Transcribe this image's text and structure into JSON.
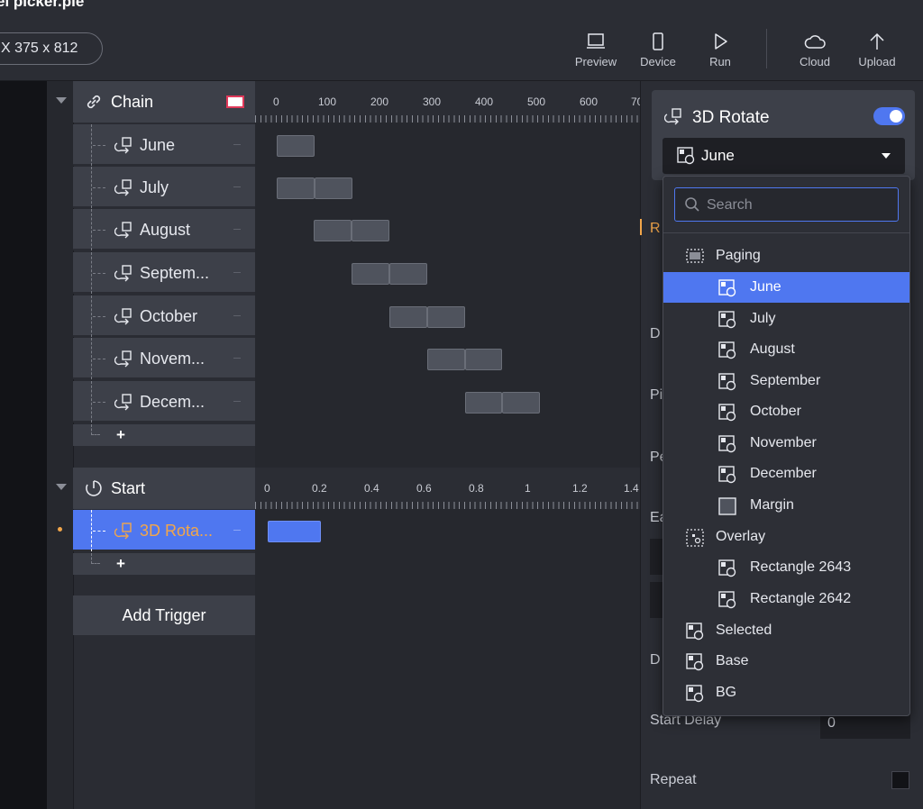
{
  "window": {
    "title": "el picker.pie"
  },
  "device": {
    "label": "X  375 x 812"
  },
  "toolbar": {
    "items": [
      {
        "label": "Preview",
        "icon": "laptop-icon"
      },
      {
        "label": "Device",
        "icon": "phone-icon"
      },
      {
        "label": "Run",
        "icon": "play-icon"
      },
      {
        "label": "Cloud",
        "icon": "cloud-icon"
      },
      {
        "label": "Upload",
        "icon": "upload-arrow-icon"
      }
    ]
  },
  "chain": {
    "title": "Chain",
    "ruler_ticks": [
      "0",
      "100",
      "200",
      "300",
      "400",
      "500",
      "600",
      "70"
    ],
    "items": [
      {
        "label": "June"
      },
      {
        "label": "July"
      },
      {
        "label": "August"
      },
      {
        "label": "Septem..."
      },
      {
        "label": "October"
      },
      {
        "label": "Novem..."
      },
      {
        "label": "Decem..."
      }
    ],
    "add_label": "+"
  },
  "start": {
    "title": "Start",
    "ruler_ticks": [
      "0",
      "0.2",
      "0.4",
      "0.6",
      "0.8",
      "1",
      "1.2",
      "1.4"
    ],
    "items": [
      {
        "label": "3D Rota..."
      }
    ],
    "add_label": "+"
  },
  "add_trigger": {
    "label": "Add Trigger"
  },
  "panel": {
    "title": "3D Rotate",
    "select_value": "June",
    "side_labels": {
      "r": "R",
      "d1": "D",
      "p1": "Pi",
      "p2": "Pe",
      "e": "Ea",
      "d2": "D",
      "start_delay": "Start Delay",
      "start_delay_value": "0",
      "repeat": "Repeat"
    }
  },
  "dropdown": {
    "search_placeholder": "Search",
    "items": [
      {
        "label": "Paging",
        "level": 0,
        "icon": "paging-group-icon"
      },
      {
        "label": "June",
        "level": 1,
        "icon": "image-layer-icon",
        "selected": true
      },
      {
        "label": "July",
        "level": 1,
        "icon": "image-layer-icon"
      },
      {
        "label": "August",
        "level": 1,
        "icon": "image-layer-icon"
      },
      {
        "label": "September",
        "level": 1,
        "icon": "image-layer-icon"
      },
      {
        "label": "October",
        "level": 1,
        "icon": "image-layer-icon"
      },
      {
        "label": "November",
        "level": 1,
        "icon": "image-layer-icon"
      },
      {
        "label": "December",
        "level": 1,
        "icon": "image-layer-icon"
      },
      {
        "label": "Margin",
        "level": 1,
        "icon": "rectangle-layer-icon"
      },
      {
        "label": "Overlay",
        "level": 0,
        "icon": "overlay-group-icon"
      },
      {
        "label": "Rectangle 2643",
        "level": 1,
        "icon": "image-layer-icon"
      },
      {
        "label": "Rectangle 2642",
        "level": 1,
        "icon": "image-layer-icon"
      },
      {
        "label": "Selected",
        "level": 0,
        "icon": "image-layer-icon"
      },
      {
        "label": "Base",
        "level": 0,
        "icon": "image-layer-icon"
      },
      {
        "label": "BG",
        "level": 0,
        "icon": "image-layer-icon"
      }
    ]
  },
  "colors": {
    "accent": "#4f77f0",
    "highlight": "#f2a64a",
    "panel": "#3d4049"
  }
}
